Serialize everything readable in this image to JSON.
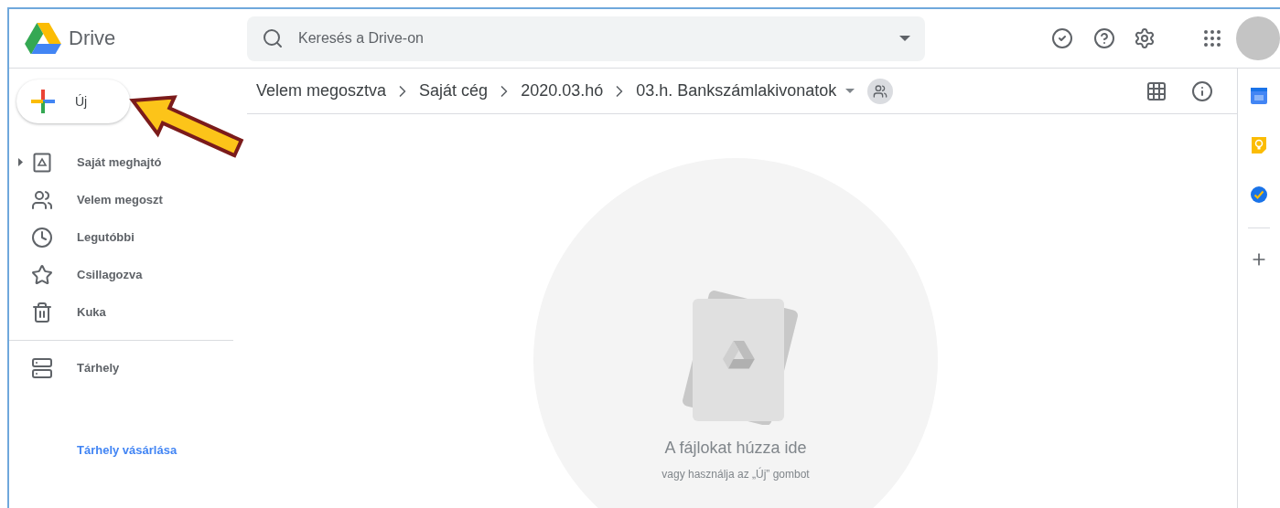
{
  "app": {
    "name": "Drive"
  },
  "search": {
    "placeholder": "Keresés a Drive-on"
  },
  "new_button": {
    "label": "Új"
  },
  "sidebar": {
    "items": [
      {
        "label": "Saját meghajtó",
        "expander": true
      },
      {
        "label": "Velem megoszt",
        "expander": false
      },
      {
        "label": "Legutóbbi",
        "expander": false
      },
      {
        "label": "Csillagozva",
        "expander": false
      },
      {
        "label": "Kuka",
        "expander": false
      }
    ],
    "storage": {
      "label": "Tárhely"
    },
    "buy_storage_link": "Tárhely vásárlása"
  },
  "breadcrumb": [
    "Velem megosztva",
    "Saját cég",
    "2020.03.hó",
    "03.h. Bankszámlakivonatok"
  ],
  "empty_state": {
    "title": "A fájlokat húzza ide",
    "subtitle": "vagy használja az „Új” gombot"
  }
}
